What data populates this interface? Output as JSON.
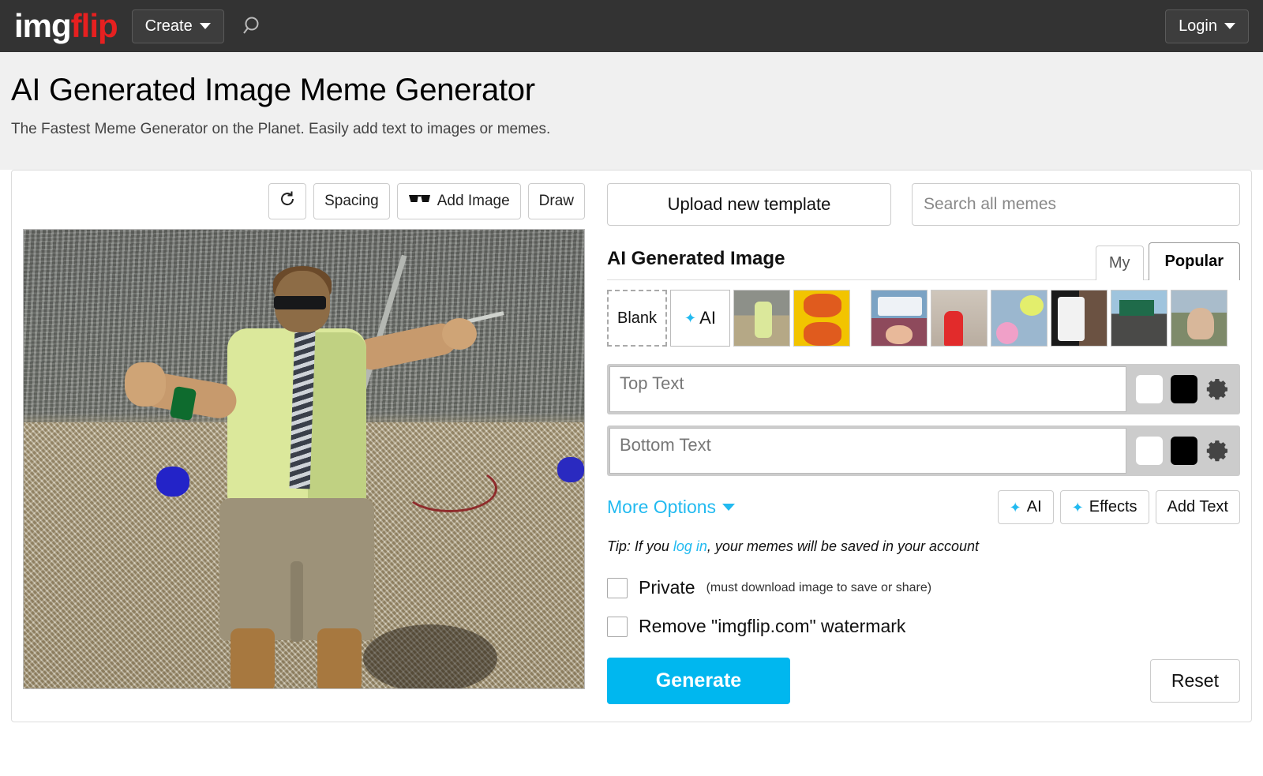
{
  "navbar": {
    "logo_img": "img",
    "logo_flip": "flip",
    "create_label": "Create",
    "search_icon": "search-icon",
    "login_label": "Login"
  },
  "page": {
    "title": "AI Generated Image Meme Generator",
    "subtitle": "The Fastest Meme Generator on the Planet. Easily add text to images or memes."
  },
  "image_toolbar": {
    "rotate_icon": "rotate-icon",
    "spacing_label": "Spacing",
    "add_image_label": "Add Image",
    "add_image_icon": "sunglasses-icon",
    "draw_label": "Draw"
  },
  "templates": {
    "upload_label": "Upload new template",
    "search_placeholder": "Search all memes",
    "section_title": "AI Generated Image",
    "tabs": [
      {
        "label": "My",
        "active": false
      },
      {
        "label": "Popular",
        "active": true
      }
    ],
    "blank_label": "Blank",
    "ai_label": "AI",
    "thumbnails": [
      "ai-generated-image-thumb",
      "drake-hotline-bling-thumb",
      "spongebob-ight-imma-head-out-thumb",
      "distracted-boyfriend-thumb",
      "monkey-puppet-thumb",
      "uno-draw-25-cards-thumb",
      "left-exit-12-off-ramp-thumb",
      "bernie-sanders-thumb"
    ]
  },
  "text_inputs": [
    {
      "placeholder": "Top Text",
      "value": "",
      "outline_color": "#ffffff",
      "fill_color": "#000000",
      "settings_icon": "gear-icon"
    },
    {
      "placeholder": "Bottom Text",
      "value": "",
      "outline_color": "#ffffff",
      "fill_color": "#000000",
      "settings_icon": "gear-icon"
    }
  ],
  "options": {
    "more_options_label": "More Options",
    "ai_label": "AI",
    "effects_label": "Effects",
    "add_text_label": "Add Text"
  },
  "tip": {
    "prefix": "Tip: If you ",
    "link": "log in",
    "suffix": ", your memes will be saved in your account"
  },
  "checkboxes": [
    {
      "label": "Private",
      "note": "(must download image to save or share)",
      "checked": false
    },
    {
      "label": "Remove \"imgflip.com\" watermark",
      "note": "",
      "checked": false
    }
  ],
  "actions": {
    "generate_label": "Generate",
    "reset_label": "Reset"
  },
  "colors": {
    "accent": "#22baf0",
    "generate": "#00b7ef",
    "logo_red": "#e62020",
    "navbar_bg": "#333333"
  }
}
